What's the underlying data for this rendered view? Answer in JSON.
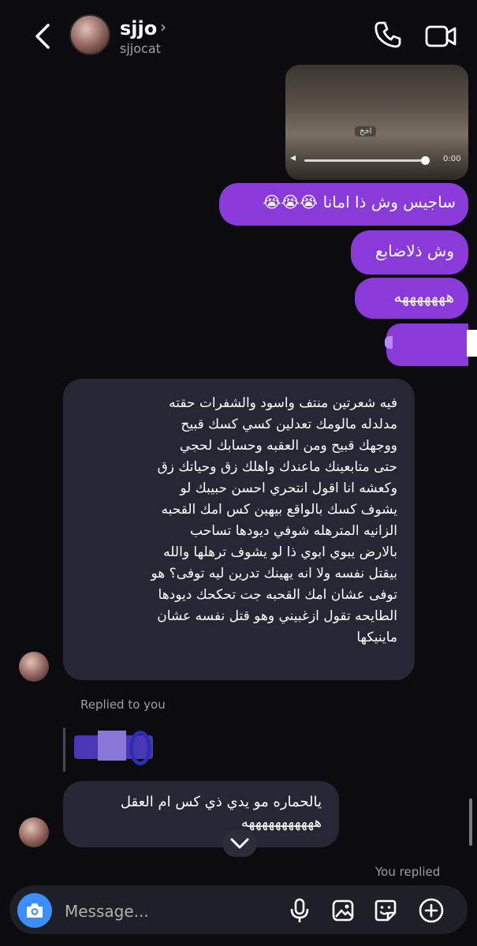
{
  "header": {
    "name": "sjjo",
    "chevron": "›",
    "username": "sjjocat",
    "icons": [
      "back-arrow-icon",
      "phone-icon",
      "video-camera-icon"
    ]
  },
  "video_message": {
    "caption": "اخخ",
    "time": "0:00"
  },
  "sent_messages": [
    "ساجيس وش ذا امانا 😭😭😭",
    "وش ذلاضابع",
    "هههههههه",
    ""
  ],
  "received_message_1": "فيه شعرتين منتف واسود والشفرات حقته\nمدلدله مالومك تعدلين كسي كسك قبيح\nووجهك قبيح ومن العقبه وحسابك لحجي\nحتى متابعينك ماعندك واهلك زق وحياتك زق\nوكعشه انا اقول انتحري احسن حبيبك لو\nيشوف كسك بالواقع بيهين كس امك القحبه\nالزانيه المترهله شوفي ديودها تساحب\nبالارض يبوي ابوي ذا لو يشوف ترهلها والله\nبيقتل نفسه ولا انه يهينك تدرين ليه توفى؟ هو\nتوفى عشان امك القحبه جت تحكحك ديودها\nالطايحه تقول ازغبيني وهو قتل نفسه عشان\nماينيكها",
  "replied_to_label": "Replied to you",
  "received_message_2": "يالحماره مو يدي ذي كس ام العقل\nهههههههههههه",
  "you_replied_label": "You replied",
  "composer": {
    "placeholder": "Message...",
    "icons": [
      "camera-icon",
      "microphone-icon",
      "gallery-icon",
      "sticker-icon",
      "plus-icon"
    ]
  },
  "colors": {
    "background": "#0b0b10",
    "sent_bubble": "#8a3ad8",
    "received_bubble": "#262634",
    "camera_button": "#3c8dff"
  }
}
